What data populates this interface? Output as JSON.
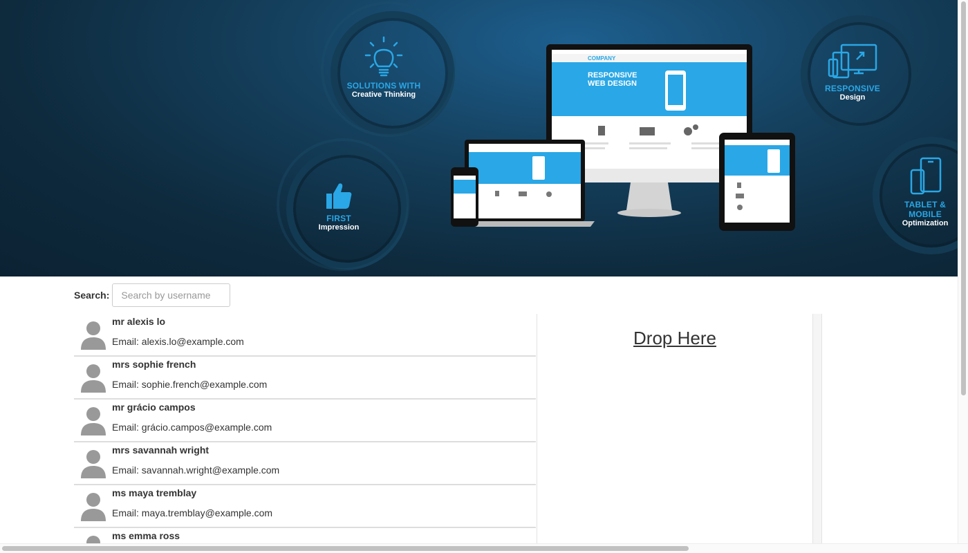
{
  "banner": {
    "features": [
      {
        "line1": "SOLUTIONS WITH",
        "line2": "Creative Thinking",
        "icon": "lightbulb-icon"
      },
      {
        "line1": "FIRST",
        "line2": "Impression",
        "icon": "thumbs-up-icon"
      },
      {
        "line1": "RESPONSIVE",
        "line2": "Design",
        "icon": "responsive-devices-icon"
      },
      {
        "line1": "TABLET & MOBILE",
        "line2": "Optimization",
        "icon": "tablet-mobile-icon"
      }
    ],
    "mockup": {
      "brand": "COMPANY",
      "headline1": "RESPONSIVE",
      "headline2": "WEB DESIGN"
    }
  },
  "search": {
    "label": "Search:",
    "placeholder": "Search by username"
  },
  "users": [
    {
      "name": "mr alexis lo",
      "email": "Email: alexis.lo@example.com"
    },
    {
      "name": "mrs sophie french",
      "email": "Email: sophie.french@example.com"
    },
    {
      "name": "mr grácio campos",
      "email": "Email: grácio.campos@example.com"
    },
    {
      "name": "mrs savannah wright",
      "email": "Email: savannah.wright@example.com"
    },
    {
      "name": "ms maya tremblay",
      "email": "Email: maya.tremblay@example.com"
    },
    {
      "name": "ms emma ross",
      "email": ""
    }
  ],
  "dropzone": {
    "title": "Drop Here"
  },
  "colors": {
    "accent": "#2aa7e6",
    "banner_dark": "#0e2a3d"
  }
}
